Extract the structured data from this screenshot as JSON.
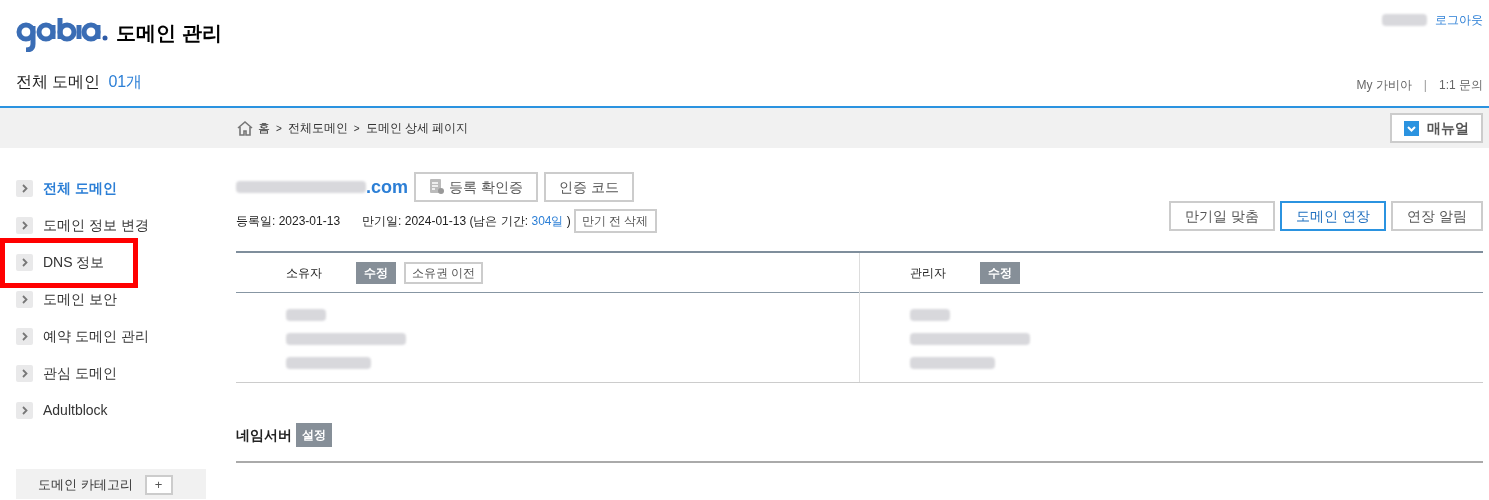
{
  "header": {
    "title": "도메인 관리",
    "count_label": "전체 도메인",
    "count": "01개",
    "logout": "로그아웃",
    "links": [
      "My 가비아",
      "1:1 문의"
    ],
    "link_separator": "|"
  },
  "breadcrumb": [
    "홈",
    "전체도메인",
    "도메인 상세 페이지"
  ],
  "breadcrumb_separator": ">",
  "manual_button": "매뉴얼",
  "sidebar": {
    "items": [
      {
        "label": "전체 도메인",
        "selected": true,
        "highlighted": false
      },
      {
        "label": "도메인 정보 변경",
        "selected": false,
        "highlighted": false
      },
      {
        "label": "DNS 정보",
        "selected": false,
        "highlighted": true
      },
      {
        "label": "도메인 보안",
        "selected": false,
        "highlighted": false
      },
      {
        "label": "예약 도메인 관리",
        "selected": false,
        "highlighted": false
      },
      {
        "label": "관심 도메인",
        "selected": false,
        "highlighted": false
      },
      {
        "label": "Adultblock",
        "selected": false,
        "highlighted": false
      }
    ],
    "category": {
      "label": "도메인 카테고리",
      "add": "+"
    }
  },
  "domain": {
    "suffix": ".com",
    "buttons": [
      "등록 확인증",
      "인증 코드"
    ],
    "registered": "등록일: 2023-01-13",
    "expires": "만기일: 2024-01-13 (남은 기간: ",
    "remaining": "304일",
    "close": " )",
    "delete_button": "만기 전 삭제",
    "actions": [
      {
        "label": "만기일 맞춤",
        "primary": false
      },
      {
        "label": "도메인 연장",
        "primary": true
      },
      {
        "label": "연장 알림",
        "primary": false
      }
    ]
  },
  "contacts": [
    {
      "title": "소유자",
      "buttons": [
        {
          "label": "수정",
          "kind": "solid"
        },
        {
          "label": "소유권 이전",
          "kind": "outline"
        }
      ]
    },
    {
      "title": "관리자",
      "buttons": [
        {
          "label": "수정",
          "kind": "solid"
        }
      ]
    }
  ],
  "nameserver": {
    "title": "네임서버",
    "button": "설정"
  }
}
